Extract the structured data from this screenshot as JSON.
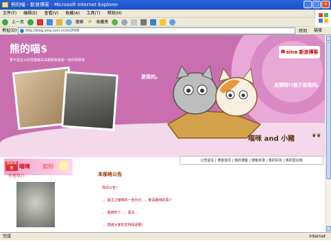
{
  "window": {
    "title": "熊的喵 - 新浪博客 - Microsoft Internet Explorer"
  },
  "menu": [
    "文件(F)",
    "编辑(E)",
    "查看(V)",
    "收藏(A)",
    "工具(T)",
    "帮助(H)"
  ],
  "toolbar": {
    "back": "上一页",
    "search": "搜索",
    "favorites": "收藏夹"
  },
  "address": {
    "label": "地址(D)",
    "url": "http://blog.sina.com.cn/m/2008",
    "go": "转到",
    "links": "链接"
  },
  "blog": {
    "title": "熊的喵$",
    "subtitle": "要不是在大的地猫最关关都想来来看一想你那那家",
    "bubble_left": "是我的。",
    "bubble_right": "走開啦!!箱子是我的。",
    "cats_name": "喵咪 and 小豬",
    "sina_label": "sina 新浪博客"
  },
  "nav": "公告留言 | 博客首页 | 我的博客 | 博客目录 | 我的好友 | 我的留言板",
  "sidebar": {
    "badge": "我的相册",
    "heading_a": "喵咪",
    "heading_b": "如何",
    "author_title": "作者简介"
  },
  "main": {
    "section_title": "本部格公告",
    "posts": [
      "简讯公告！",
      "．．其主之喵咪的一些日记...，敬请期待的事!!",
      "．．謝謝你了．．．留言...",
      "．．感謝大家的支持與喜歡！"
    ]
  },
  "status": {
    "left": "完成",
    "right": "Internet"
  }
}
